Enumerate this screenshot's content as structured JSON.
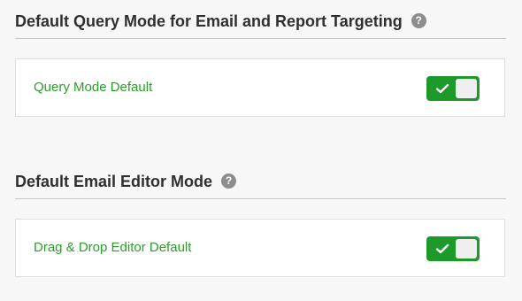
{
  "sections": [
    {
      "title": "Default Query Mode for Email and Report Targeting",
      "help_icon": "question-circle-icon",
      "setting": {
        "label": "Query Mode Default",
        "enabled": true
      }
    },
    {
      "title": "Default Email Editor Mode",
      "help_icon": "question-circle-icon",
      "setting": {
        "label": "Drag & Drop Editor Default",
        "enabled": true
      }
    }
  ],
  "colors": {
    "label_green": "#2aa02a",
    "toggle_on": "#1e9a2b",
    "help_icon_gray": "#8d8d8d"
  },
  "help_glyph": "?"
}
